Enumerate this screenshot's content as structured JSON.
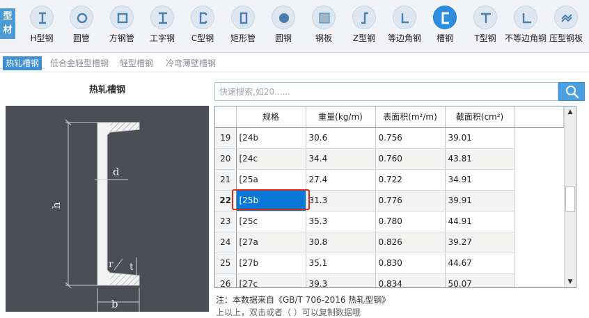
{
  "category_tag": "型材",
  "toolbar": {
    "items": [
      {
        "label": "H型钢",
        "icon": "h-beam-icon"
      },
      {
        "label": "圆管",
        "icon": "round-tube-icon"
      },
      {
        "label": "方钢管",
        "icon": "square-tube-icon"
      },
      {
        "label": "工字钢",
        "icon": "i-beam-icon"
      },
      {
        "label": "C型钢",
        "icon": "c-section-icon"
      },
      {
        "label": "矩形管",
        "icon": "rect-tube-icon"
      },
      {
        "label": "圆钢",
        "icon": "round-bar-icon"
      },
      {
        "label": "钢板",
        "icon": "steel-plate-icon"
      },
      {
        "label": "Z型钢",
        "icon": "z-section-icon"
      },
      {
        "label": "等边角钢",
        "icon": "equal-angle-icon"
      },
      {
        "label": "槽钢",
        "icon": "channel-icon",
        "active": true
      },
      {
        "label": "T型钢",
        "icon": "t-section-icon"
      },
      {
        "label": "不等边角钢",
        "icon": "unequal-angle-icon"
      },
      {
        "label": "压型钢板",
        "icon": "profiled-sheet-icon"
      }
    ]
  },
  "subtabs": [
    {
      "label": "热轧槽钢",
      "active": true
    },
    {
      "label": "低合金轻型槽钢"
    },
    {
      "label": "轻型槽钢"
    },
    {
      "label": "冷弯薄壁槽钢"
    }
  ],
  "left_panel": {
    "title": "热轧槽钢",
    "diagram_labels": {
      "h": "h",
      "b": "b",
      "d": "d",
      "t": "t",
      "r": "r"
    }
  },
  "search": {
    "placeholder": "快速搜索,如20......"
  },
  "table": {
    "headers": [
      "规格",
      "重量(kg/m)",
      "表面积(m²/m)",
      "截面积(cm²)"
    ],
    "rows": [
      {
        "no": "19",
        "spec": "[24b",
        "weight": "30.6",
        "surface": "0.756",
        "area": "39.01"
      },
      {
        "no": "20",
        "spec": "[24c",
        "weight": "34.4",
        "surface": "0.760",
        "area": "43.81"
      },
      {
        "no": "21",
        "spec": "[25a",
        "weight": "27.4",
        "surface": "0.722",
        "area": "34.91"
      },
      {
        "no": "22",
        "spec": "[25b",
        "weight": "31.3",
        "surface": "0.776",
        "area": "39.91"
      },
      {
        "no": "23",
        "spec": "[25c",
        "weight": "35.3",
        "surface": "0.780",
        "area": "44.91"
      },
      {
        "no": "24",
        "spec": "[27a",
        "weight": "30.8",
        "surface": "0.826",
        "area": "39.27"
      },
      {
        "no": "25",
        "spec": "[27b",
        "weight": "35.1",
        "surface": "0.830",
        "area": "44.67"
      },
      {
        "no": "26",
        "spec": "[27c",
        "weight": "39.3",
        "surface": "0.834",
        "area": "50.07"
      }
    ],
    "selected_row": "22"
  },
  "footer": {
    "note": "注：本数据来自《GB/T 706-2016  热轧型钢》",
    "note2": "上以上，双击或者（  ）可以复制数据哦"
  },
  "colors": {
    "accent": "#3b8fd8",
    "selection": "#0a78d7",
    "highlight_border": "#e0291d",
    "diagram_bg": "#4b4e55"
  }
}
